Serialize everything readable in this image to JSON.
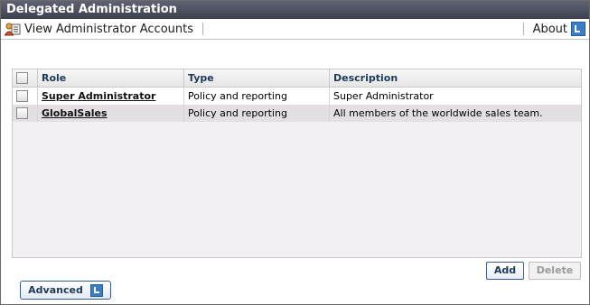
{
  "window": {
    "title": "Delegated Administration"
  },
  "toolbar": {
    "view_accounts_label": "View Administrator Accounts",
    "about_label": "About"
  },
  "table": {
    "columns": [
      "Role",
      "Type",
      "Description"
    ],
    "rows": [
      {
        "role": "Super Administrator",
        "type": "Policy and reporting",
        "description": "Super Administrator"
      },
      {
        "role": "GlobalSales",
        "type": "Policy and reporting",
        "description": "All members of the worldwide sales team."
      }
    ]
  },
  "buttons": {
    "add_label": "Add",
    "delete_label": "Delete",
    "advanced_label": "Advanced"
  }
}
